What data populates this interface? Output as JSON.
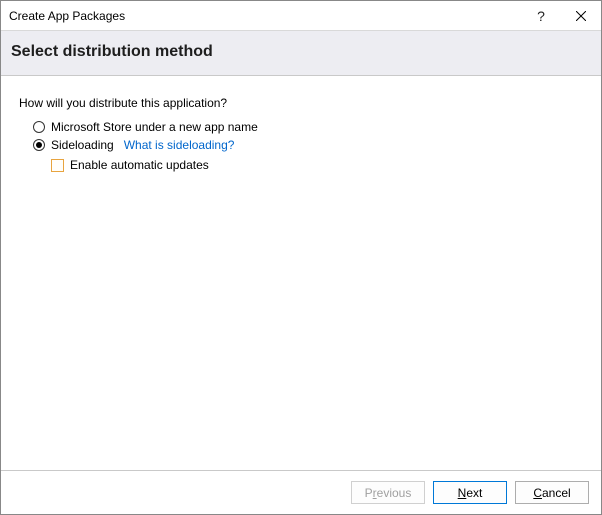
{
  "window": {
    "title": "Create App Packages"
  },
  "header": {
    "title": "Select distribution method"
  },
  "body": {
    "question": "How will you distribute this application?",
    "option_store": "Microsoft Store under a new app name",
    "option_sideload": "Sideloading",
    "sideload_help": "What is sideloading?",
    "enable_updates": "Enable automatic updates"
  },
  "footer": {
    "previous_prefix": "P",
    "previous_mn": "r",
    "previous_suffix": "evious",
    "next_mn": "N",
    "next_suffix": "ext",
    "cancel_mn": "C",
    "cancel_suffix": "ancel"
  }
}
